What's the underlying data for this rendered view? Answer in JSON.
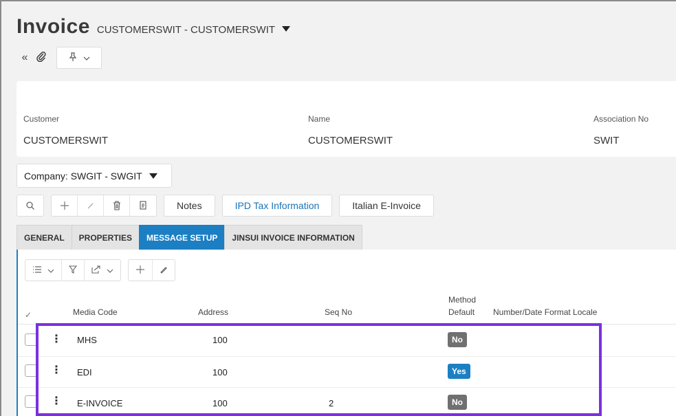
{
  "page": {
    "title": "Invoice",
    "subtitle": "CUSTOMERSWIT - CUSTOMERSWIT"
  },
  "nav": {
    "back_icon": "double-chevron-left-icon",
    "attach_icon": "paperclip-icon",
    "pin_icon": "pin-icon"
  },
  "header": {
    "customer_label": "Customer",
    "customer_value": "CUSTOMERSWIT",
    "name_label": "Name",
    "name_value": "CUSTOMERSWIT",
    "association_label": "Association No",
    "association_value": "SWIT"
  },
  "company_select": {
    "value": "Company: SWGIT - SWGIT"
  },
  "toolbar": {
    "icons": [
      "search-icon",
      "plus-icon",
      "pencil-icon",
      "trash-icon",
      "copy-icon"
    ],
    "notes_label": "Notes",
    "ipd_label": "IPD Tax Information",
    "italian_label": "Italian E-Invoice",
    "accent_color": "#1a73b8"
  },
  "tabs": [
    {
      "label": "GENERAL",
      "active": false
    },
    {
      "label": "PROPERTIES",
      "active": false
    },
    {
      "label": "MESSAGE SETUP",
      "active": true
    },
    {
      "label": "JINSUI INVOICE INFORMATION",
      "active": false
    }
  ],
  "grid_toolbar": {
    "icons": [
      "list-icon",
      "chevron-down-icon",
      "filter-icon",
      "export-icon",
      "plus-icon",
      "pencil-icon"
    ]
  },
  "table": {
    "columns": {
      "check": "✓",
      "media_code": "Media Code",
      "address": "Address",
      "seq_no": "Seq No",
      "method_default_1": "Method",
      "method_default_2": "Default",
      "locale": "Number/Date Format Locale"
    },
    "rows": [
      {
        "media_code": "MHS",
        "address": "100",
        "seq_no": "",
        "method_default": "No"
      },
      {
        "media_code": "EDI",
        "address": "100",
        "seq_no": "",
        "method_default": "Yes"
      },
      {
        "media_code": "E-INVOICE",
        "address": "100",
        "seq_no": "2",
        "method_default": "No"
      }
    ]
  },
  "colors": {
    "active_tab": "#1c7fc3",
    "badge_yes": "#1c7fc3",
    "badge_no": "#707070",
    "highlight": "#7b2fe0"
  }
}
